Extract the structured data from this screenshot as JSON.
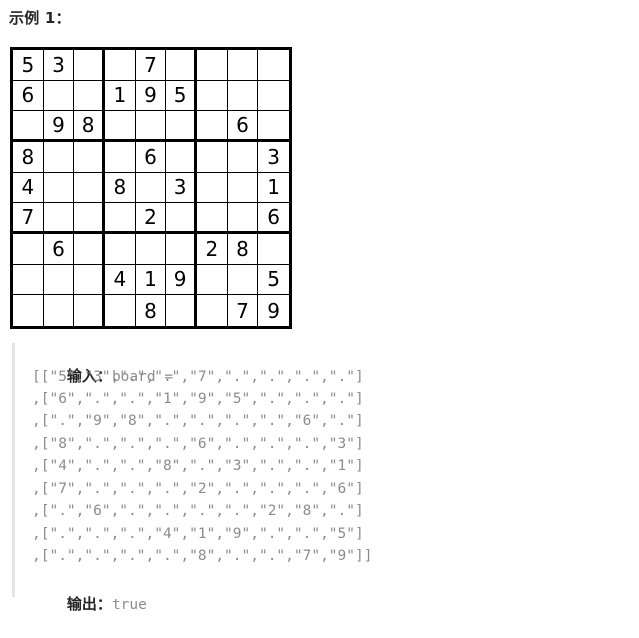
{
  "heading": "示例 1：",
  "board": [
    [
      "5",
      "3",
      "",
      "",
      "7",
      "",
      "",
      "",
      ""
    ],
    [
      "6",
      "",
      "",
      "1",
      "9",
      "5",
      "",
      "",
      ""
    ],
    [
      "",
      "9",
      "8",
      "",
      "",
      "",
      "",
      "6",
      ""
    ],
    [
      "8",
      "",
      "",
      "",
      "6",
      "",
      "",
      "",
      "3"
    ],
    [
      "4",
      "",
      "",
      "8",
      "",
      "3",
      "",
      "",
      "1"
    ],
    [
      "7",
      "",
      "",
      "",
      "2",
      "",
      "",
      "",
      "6"
    ],
    [
      "",
      "6",
      "",
      "",
      "",
      "",
      "2",
      "8",
      ""
    ],
    [
      "",
      "",
      "",
      "4",
      "1",
      "9",
      "",
      "",
      "5"
    ],
    [
      "",
      "",
      "",
      "",
      "8",
      "",
      "",
      "7",
      "9"
    ]
  ],
  "example": {
    "input_label": "输入：",
    "input_value": "board =",
    "board_lines": [
      "[[\"5\",\"3\",\".\",\".\",\"7\",\".\",\".\",\".\",\".\"]",
      ",[\"6\",\".\",\".\",\"1\",\"9\",\"5\",\".\",\".\",\".\"]",
      ",[\".\",\"9\",\"8\",\".\",\".\",\".\",\".\",\"6\",\".\"]",
      ",[\"8\",\".\",\".\",\".\",\"6\",\".\",\".\",\".\",\"3\"]",
      ",[\"4\",\".\",\".\",\"8\",\".\",\"3\",\".\",\".\",\"1\"]",
      ",[\"7\",\".\",\".\",\".\",\"2\",\".\",\".\",\".\",\"6\"]",
      ",[\".\",\"6\",\".\",\".\",\".\",\".\",\"2\",\"8\",\".\"]",
      ",[\".\",\".\",\".\",\"4\",\"1\",\"9\",\".\",\".\",\"5\"]",
      ",[\".\",\".\",\".\",\".\",\"8\",\".\",\".\",\"7\",\"9\"]]"
    ],
    "output_label": "输出：",
    "output_value": "true"
  }
}
